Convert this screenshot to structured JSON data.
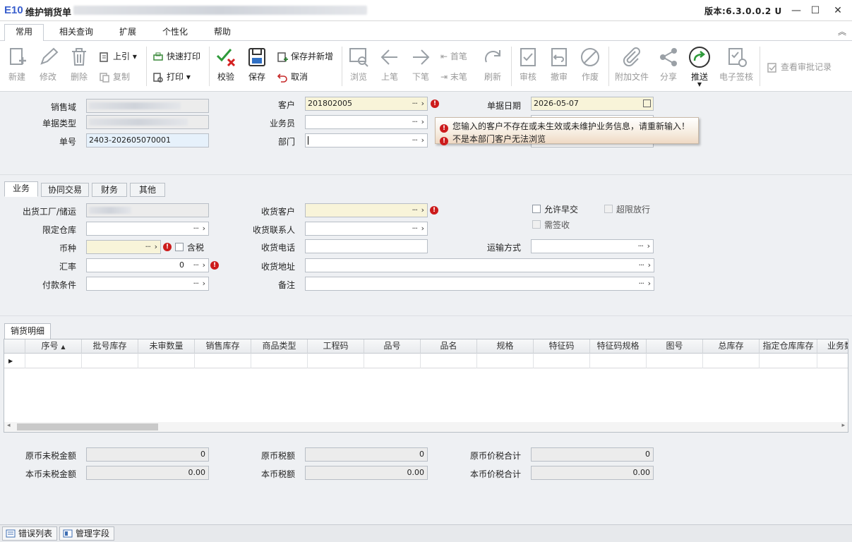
{
  "window": {
    "logo": "E10",
    "title": "维护销货单",
    "version": "版本:6.3.0.0.2 U"
  },
  "menu_tabs": [
    "常用",
    "相关查询",
    "扩展",
    "个性化",
    "帮助"
  ],
  "toolbar": {
    "new": "新建",
    "edit": "修改",
    "delete": "删除",
    "import": "上引",
    "copy": "复制",
    "quick_print": "快速打印",
    "print": "打印",
    "verify": "校验",
    "save": "保存",
    "save_new": "保存并新增",
    "cancel": "取消",
    "browse": "浏览",
    "prev": "上笔",
    "next": "下笔",
    "first": "首笔",
    "last": "末笔",
    "refresh": "刷新",
    "approve": "审核",
    "unapprove": "撤审",
    "void": "作废",
    "attach": "附加文件",
    "share": "分享",
    "push": "推送",
    "esign": "电子签核",
    "approval_log": "查看审批记录"
  },
  "header_form": {
    "sales_domain_label": "销售域",
    "doc_type_label": "单据类型",
    "doc_no_label": "单号",
    "doc_no": "2403-202605070001",
    "customer_label": "客户",
    "customer": "201802005",
    "salesperson_label": "业务员",
    "department_label": "部门",
    "doc_date_label": "单据日期",
    "doc_date": "2026-05-07"
  },
  "tooltip": {
    "line1": "您输入的客户不存在或未生效或未维护业务信息，请重新输入！",
    "line2": "不是本部门客户无法浏览"
  },
  "sub_tabs": [
    "业务",
    "协同交易",
    "财务",
    "其他"
  ],
  "business": {
    "factory_label": "出货工厂/储运",
    "warehouse_label": "限定仓库",
    "currency_label": "币种",
    "tax_incl_label": "含税",
    "exchange_rate_label": "汇率",
    "exchange_rate": "0",
    "payment_terms_label": "付款条件",
    "recv_customer_label": "收货客户",
    "recv_contact_label": "收货联系人",
    "recv_phone_label": "收货电话",
    "recv_address_label": "收货地址",
    "remark_label": "备注",
    "allow_early_label": "允许早交",
    "over_limit_label": "超限放行",
    "need_sign_label": "需签收",
    "shipping_label": "运输方式"
  },
  "detail": {
    "tab": "销货明细",
    "columns": [
      "序号",
      "批号库存",
      "未审数量",
      "销售库存",
      "商品类型",
      "工程码",
      "品号",
      "品名",
      "规格",
      "特征码",
      "特征码规格",
      "图号",
      "总库存",
      "指定仓库库存",
      "业务数"
    ]
  },
  "totals": {
    "orig_untaxed_label": "原币未税金额",
    "orig_untaxed": "0",
    "local_untaxed_label": "本币未税金额",
    "local_untaxed": "0.00",
    "orig_tax_label": "原币税额",
    "orig_tax": "0",
    "local_tax_label": "本币税额",
    "local_tax": "0.00",
    "orig_total_label": "原币价税合计",
    "orig_total": "0",
    "local_total_label": "本币价税合计",
    "local_total": "0.00"
  },
  "status_bar": {
    "error_list": "错误列表",
    "manage_fields": "管理字段"
  }
}
